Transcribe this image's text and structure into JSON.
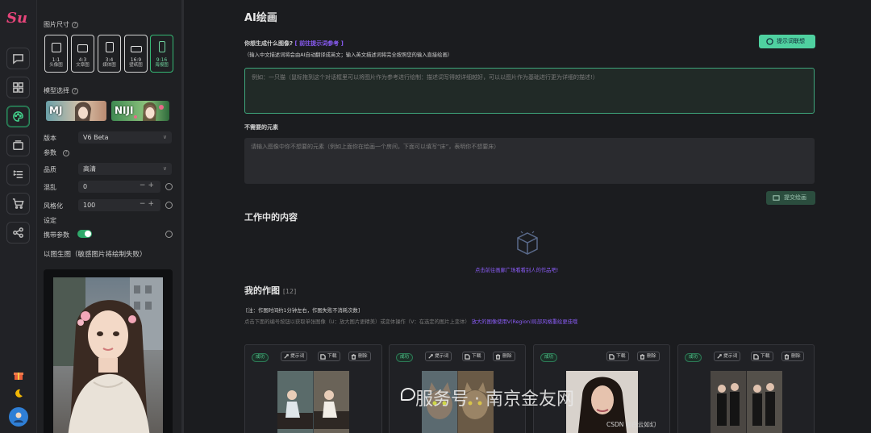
{
  "logo_text": "Su",
  "sidebar": {
    "size_label": "图片尺寸",
    "ratios": [
      {
        "ratio": "1:1",
        "name": "头像图"
      },
      {
        "ratio": "4:3",
        "name": "文章图"
      },
      {
        "ratio": "3:4",
        "name": "媒体图"
      },
      {
        "ratio": "16:9",
        "name": "壁纸图"
      },
      {
        "ratio": "9:16",
        "name": "海报图"
      }
    ],
    "selected_ratio": "9:16",
    "model_label": "模型选择",
    "models": [
      "MJ",
      "NIJI"
    ],
    "version_label": "版本",
    "version_value": "V6 Beta",
    "params_label": "参数",
    "quality_label": "品质",
    "quality_value": "高清",
    "chaos_label": "混乱",
    "chaos_value": "0",
    "stylize_label": "风格化",
    "stylize_value": "100",
    "settings_label": "设定",
    "carry_params_label": "携带参数",
    "carry_params_on": true,
    "img2img_label": "以图生图（敏感图片将绘制失败）"
  },
  "main": {
    "title": "AI绘画",
    "prompt_question": "你想生成什么图像?",
    "prompt_link": "[ 前往提示词参考 ]",
    "prompt_hint": "（输入中文描述词将会由AI自动翻译成英文；输入英文描述词将完全按照您的输入直接绘画）",
    "prompt_library_button": "提示词联想",
    "prompt_placeholder": "例如：一只猫（鼠标拖到这个对话框里可以将图片作为参考进行绘制：描述词写得越详细越好，可以以图片作为基础进行更为详细的描述!）",
    "negative_label": "不需要的元素",
    "negative_placeholder": "请输入图像中你不想要的元素（例如上面你在绘画一个房间，下面可以填写“床”，表明你不想要床）",
    "submit_button": "提交绘画",
    "working_title": "工作中的内容",
    "empty_link": "点击前往画廊广场看看别人的作品吧!",
    "my_works_title": "我的作图",
    "my_works_count": "[12]",
    "note1": "[注：作图时间约1分钟左右，作图失败不消耗次数]",
    "note2": "点击下面的编号按钮以获取单张图像（U：放大图片更精美）或变体操作（V：在选定的图片上变体）",
    "note2_link": "放大的图像使用V(Region)局部风格重绘更佳哦",
    "cards": [
      {
        "status": "成功",
        "buttons": [
          "提示词",
          "下载",
          "删除"
        ]
      },
      {
        "status": "成功",
        "buttons": [
          "提示词",
          "下载",
          "删除"
        ]
      },
      {
        "status": "成功",
        "buttons": [
          "下载",
          "删除"
        ]
      },
      {
        "status": "成功",
        "buttons": [
          "提示词",
          "下载",
          "删除"
        ]
      }
    ]
  },
  "watermark": "服务号 · 南京金友网",
  "csdn": "CSDN @白云如幻"
}
